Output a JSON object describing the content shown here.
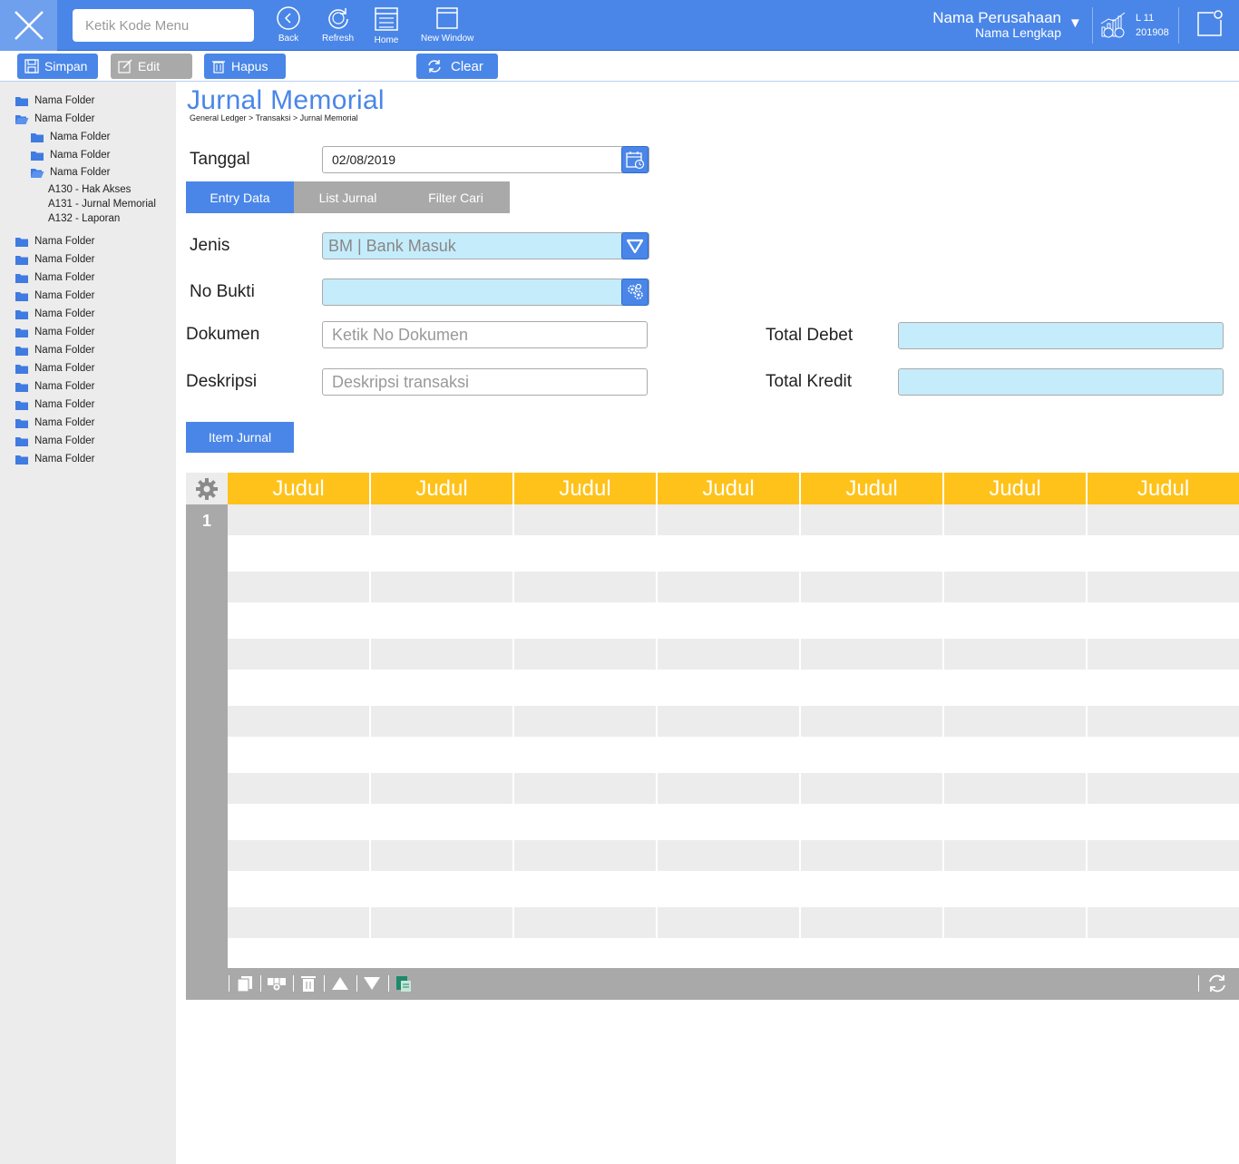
{
  "topbar": {
    "menu_search_placeholder": "Ketik Kode Menu",
    "buttons": [
      {
        "label": "Back",
        "icon": "back-icon"
      },
      {
        "label": "Refresh",
        "icon": "refresh-icon"
      },
      {
        "label": "Home",
        "icon": "home-icon"
      },
      {
        "label": "New Window",
        "icon": "new-window-icon"
      }
    ],
    "company_name": "Nama Perusahaan",
    "company_full": "Nama Lengkap",
    "period_level": "L 11",
    "period_code": "201908",
    "accent_color": "#4a86e8"
  },
  "actions": {
    "save": "Simpan",
    "edit": "Edit",
    "delete": "Hapus",
    "clear": "Clear"
  },
  "sidebar": {
    "folders": [
      {
        "label": "Nama Folder",
        "open": false
      },
      {
        "label": "Nama Folder",
        "open": true
      },
      {
        "label": "Nama Folder",
        "open": false
      },
      {
        "label": "Nama Folder",
        "open": false
      },
      {
        "label": "Nama Folder",
        "open": true
      }
    ],
    "leaves": [
      "A130 - Hak Akses",
      "A131 - Jurnal Memorial",
      "A132 - Laporan"
    ],
    "more_folders": [
      "Nama Folder",
      "Nama Folder",
      "Nama Folder",
      "Nama Folder",
      "Nama Folder",
      "Nama Folder",
      "Nama Folder",
      "Nama Folder",
      "Nama Folder",
      "Nama Folder",
      "Nama Folder",
      "Nama Folder",
      "Nama Folder"
    ]
  },
  "page": {
    "title": "Jurnal Memorial",
    "breadcrumb": "General Ledger > Transaksi > Jurnal Memorial"
  },
  "form": {
    "tanggal_label": "Tanggal",
    "tanggal_value": "02/08/2019",
    "tabs": [
      "Entry Data",
      "List Jurnal",
      "Filter Cari"
    ],
    "jenis_label": "Jenis",
    "jenis_value": "BM | Bank Masuk",
    "nobukti_label": "No Bukti",
    "nobukti_value": "",
    "dokumen_label": "Dokumen",
    "dokumen_placeholder": "Ketik No Dokumen",
    "deskripsi_label": "Deskripsi",
    "deskripsi_placeholder": "Deskripsi transaksi",
    "total_debet_label": "Total Debet",
    "total_kredit_label": "Total Kredit",
    "item_jurnal_button": "Item Jurnal"
  },
  "grid": {
    "headers": [
      "Judul",
      "Judul",
      "Judul",
      "Judul",
      "Judul",
      "Judul",
      "Judul"
    ],
    "row_numbers": [
      "1"
    ],
    "header_color": "#ffc21a"
  }
}
